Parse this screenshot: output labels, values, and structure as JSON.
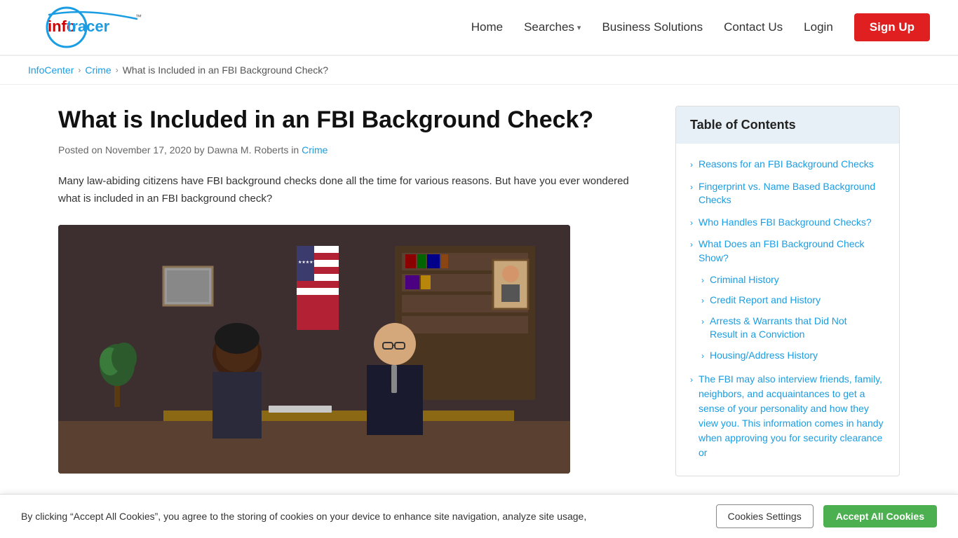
{
  "nav": {
    "logo_text": "info tracer",
    "logo_tm": "™",
    "links": [
      {
        "label": "Home",
        "name": "home-link"
      },
      {
        "label": "Searches",
        "name": "searches-link",
        "has_dropdown": true
      },
      {
        "label": "Business Solutions",
        "name": "business-solutions-link"
      },
      {
        "label": "Contact Us",
        "name": "contact-us-link"
      },
      {
        "label": "Login",
        "name": "login-link"
      }
    ],
    "signup_label": "Sign Up"
  },
  "breadcrumb": {
    "items": [
      {
        "label": "InfoCenter",
        "href": "#"
      },
      {
        "label": "Crime",
        "href": "#"
      },
      {
        "label": "What is Included in an FBI Background Check?",
        "href": "#"
      }
    ]
  },
  "article": {
    "title": "What is Included in an FBI Background Check?",
    "meta": "Posted on November 17, 2020 by Dawna M. Roberts in",
    "meta_link": "Crime",
    "intro": "Many law-abiding citizens have FBI background checks done all the time for various reasons. But have you ever wondered what is included in an FBI background check?"
  },
  "toc": {
    "header": "Table of Contents",
    "items": [
      {
        "label": "Reasons for an FBI Background Checks",
        "indent": false
      },
      {
        "label": "Fingerprint vs. Name Based Background Checks",
        "indent": false
      },
      {
        "label": "Who Handles FBI Background Checks?",
        "indent": false
      },
      {
        "label": "What Does an FBI Background Check Show?",
        "indent": false
      },
      {
        "label": "Criminal History",
        "indent": true
      },
      {
        "label": "Credit Report and History",
        "indent": true
      },
      {
        "label": "Arrests & Warrants that Did Not Result in a Conviction",
        "indent": true
      },
      {
        "label": "Housing/Address History",
        "indent": true
      }
    ],
    "long_item": "The FBI may also interview friends, family, neighbors, and acquaintances to get a sense of your personality and how they view you. This information comes in handy when approving you for security clearance or"
  },
  "cookie_banner": {
    "text": "By clicking “Accept All Cookies”, you agree to the storing of cookies on your device to enhance site navigation, analyze site usage,",
    "settings_label": "Cookies Settings",
    "accept_label": "Accept All Cookies"
  }
}
